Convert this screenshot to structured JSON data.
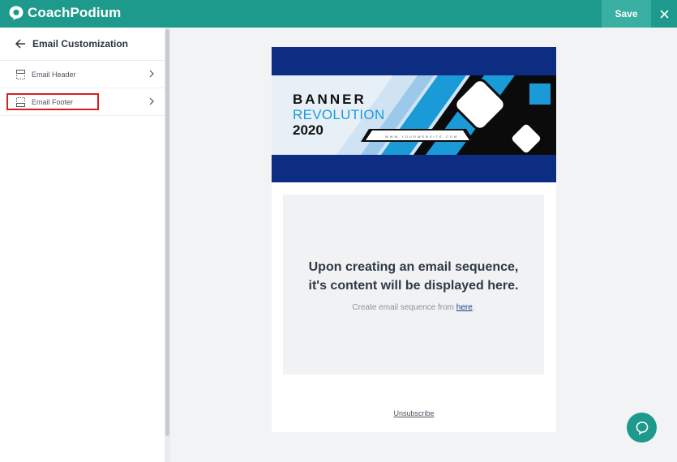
{
  "app": {
    "name": "CoachPodium"
  },
  "topbar": {
    "save_label": "Save"
  },
  "sidebar": {
    "title": "Email Customization",
    "items": [
      {
        "label": "Email Header",
        "icon": "header-layout-icon"
      },
      {
        "label": "Email Footer",
        "icon": "footer-layout-icon",
        "highlighted": true
      }
    ]
  },
  "email": {
    "banner": {
      "line1": "BANNER",
      "line2": "REVOLUTION",
      "line3": "2020",
      "website": "WWW.YOURWEBSITE.COM"
    },
    "placeholder": {
      "title_line1": "Upon creating an email sequence,",
      "title_line2": "it's content will be displayed here.",
      "subtitle_prefix": "Create email sequence from ",
      "subtitle_link": "here",
      "subtitle_suffix": "."
    },
    "unsubscribe": "Unsubscribe"
  },
  "colors": {
    "brand": "#1e9a8c",
    "banner_navy": "#0d2d82",
    "banner_blue": "#1b9ad8",
    "highlight": "#d81e1e"
  }
}
